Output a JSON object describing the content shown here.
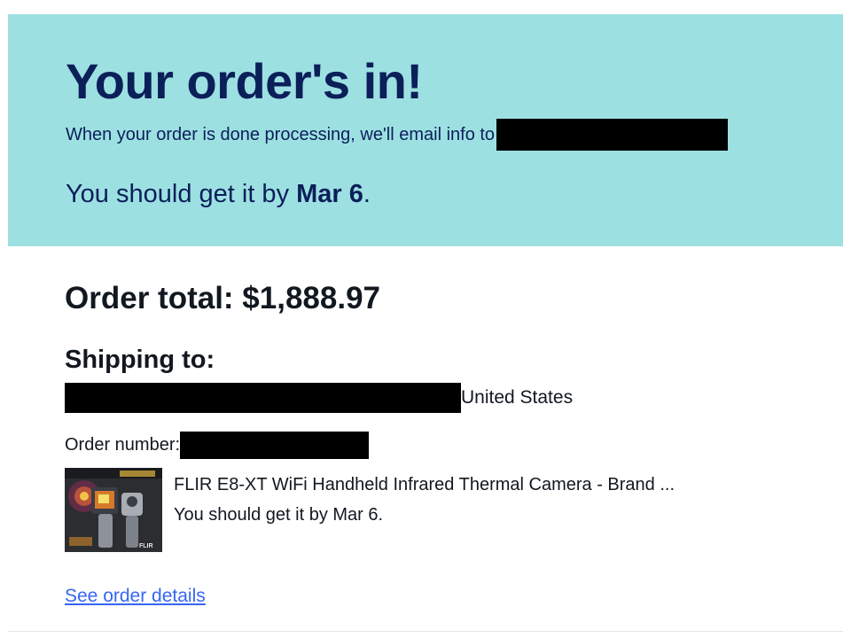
{
  "banner": {
    "title": "Your order's in!",
    "email_text": "When your order is done processing, we'll email info to",
    "delivery_prefix": "You should get it by ",
    "delivery_date": "Mar 6",
    "delivery_suffix": ".",
    "background_color": "#9de0e2",
    "text_color": "#0b1f59"
  },
  "order": {
    "total_label": "Order total: ",
    "total_value": "$1,888.97"
  },
  "shipping": {
    "heading": "Shipping to:",
    "country": "United States"
  },
  "order_number": {
    "label": "Order number:"
  },
  "item": {
    "title": "FLIR E8-XT WiFi Handheld Infrared Thermal Camera - Brand ...",
    "delivery": "You should get it by Mar 6.",
    "image_icon": "product-thumbnail",
    "brand_mark": "FLIR"
  },
  "links": {
    "order_details": "See order details",
    "link_color": "#3665f3"
  }
}
